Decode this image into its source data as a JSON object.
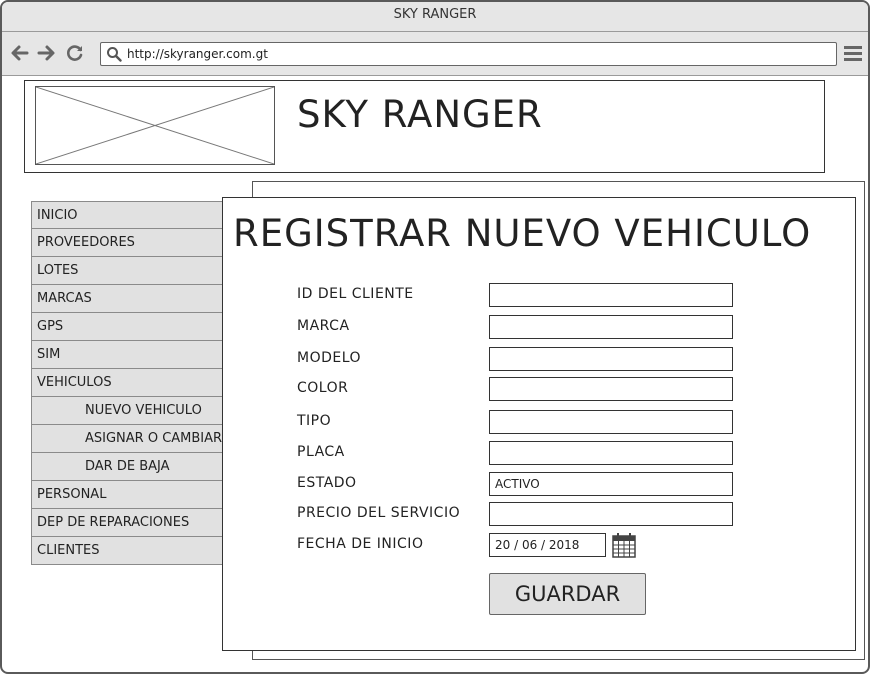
{
  "browser": {
    "window_title": "SKY RANGER",
    "url": "http://skyranger.com.gt",
    "icons": [
      "back-arrow-icon",
      "forward-arrow-icon",
      "refresh-icon",
      "search-icon",
      "hamburger-menu-icon"
    ]
  },
  "header": {
    "site_title": "SKY RANGER"
  },
  "sidebar": {
    "items": [
      {
        "label": "INICIO"
      },
      {
        "label": "PROVEEDORES"
      },
      {
        "label": "LOTES"
      },
      {
        "label": "MARCAS"
      },
      {
        "label": "GPS"
      },
      {
        "label": "SIM"
      },
      {
        "label": "VEHICULOS"
      },
      {
        "label": "NUEVO VEHICULO"
      },
      {
        "label": "ASIGNAR O CAMBIAR"
      },
      {
        "label": "DAR DE BAJA"
      },
      {
        "label": "PERSONAL"
      },
      {
        "label": "DEP DE REPARACIONES"
      },
      {
        "label": "CLIENTES"
      }
    ]
  },
  "form": {
    "title": "REGISTRAR NUEVO VEHICULO",
    "fields": [
      {
        "label": "ID  DEL CLIENTE",
        "value": ""
      },
      {
        "label": "MARCA",
        "value": ""
      },
      {
        "label": "MODELO",
        "value": ""
      },
      {
        "label": "COLOR",
        "value": ""
      },
      {
        "label": "TIPO",
        "value": ""
      },
      {
        "label": "PLACA",
        "value": ""
      },
      {
        "label": "ESTADO",
        "value": "ACTIVO"
      },
      {
        "label": "PRECIO DEL SERVICIO",
        "value": ""
      },
      {
        "label": "FECHA DE INICIO",
        "value": "20 / 06 / 2018"
      }
    ],
    "save_label": "GUARDAR"
  }
}
